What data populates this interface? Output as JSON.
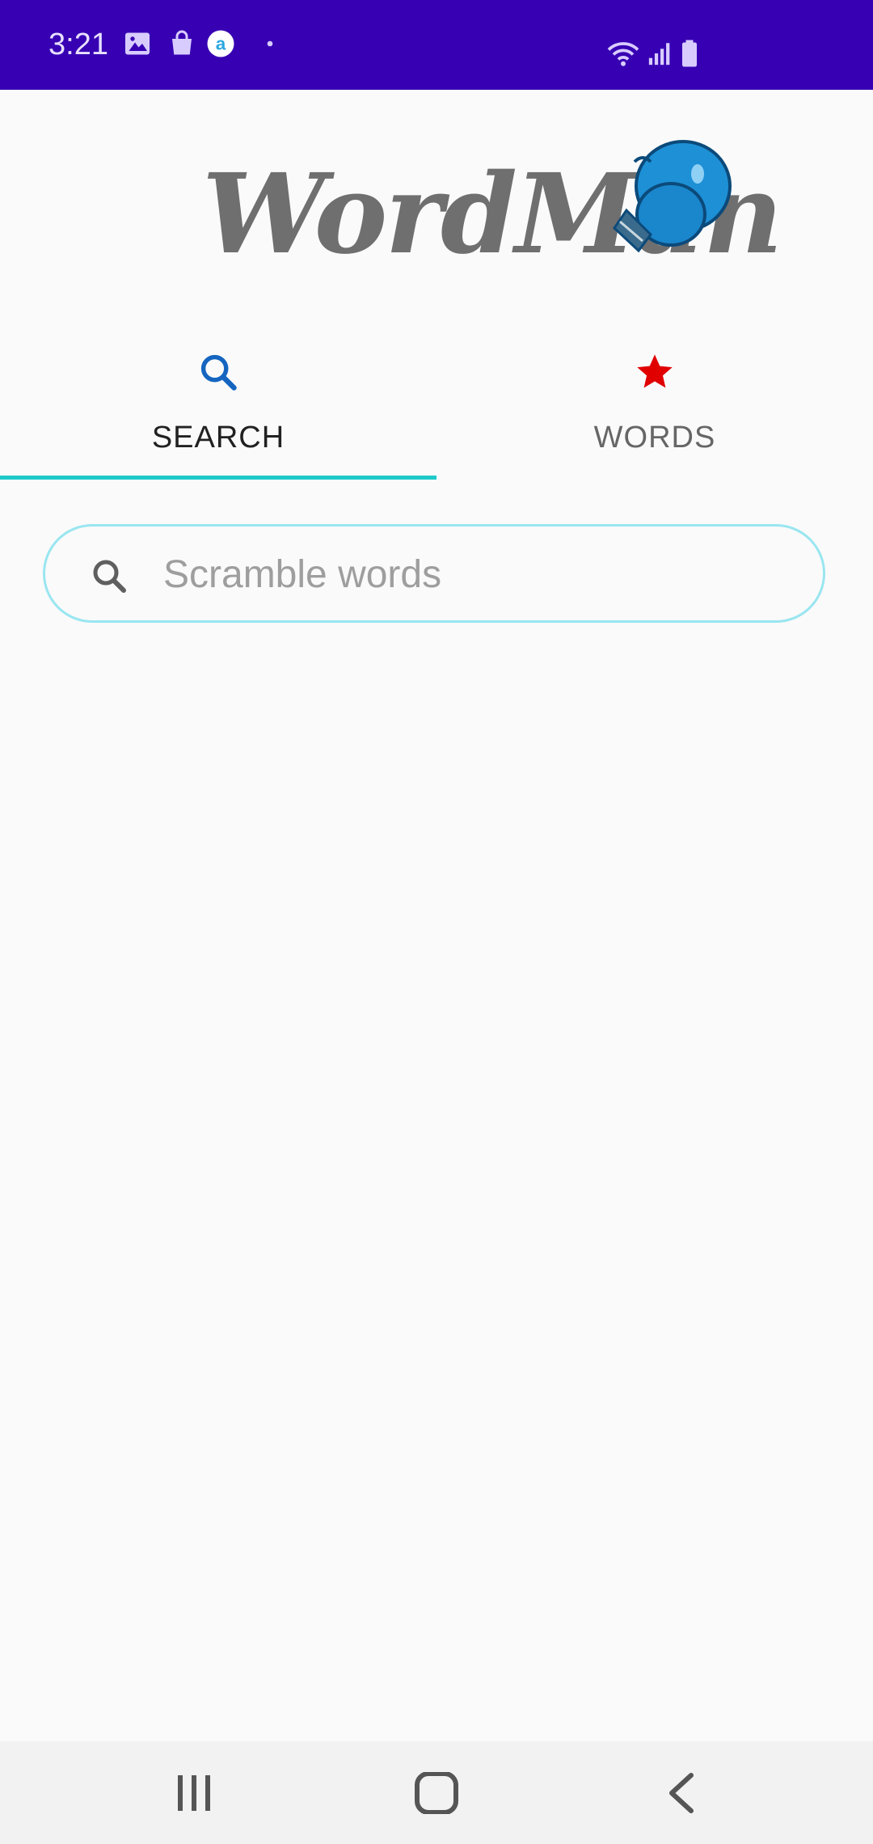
{
  "status_bar": {
    "time": "3:21",
    "background": "#3700b3",
    "left_icons": [
      "gallery-icon",
      "shopping-bag-icon",
      "app-notification-icon",
      "dot-icon"
    ],
    "right_icons": [
      "wifi-icon",
      "signal-icon",
      "battery-icon"
    ]
  },
  "logo": {
    "text": "WordMan",
    "image": "boxing-glove-icon"
  },
  "tabs": [
    {
      "label": "SEARCH",
      "icon": "search-icon",
      "active": true,
      "icon_color": "#1565c0"
    },
    {
      "label": "WORDS",
      "icon": "star-icon",
      "active": false,
      "icon_color": "#e00000"
    }
  ],
  "accent_color": "#1fc9c9",
  "search": {
    "placeholder": "Scramble words",
    "value": ""
  },
  "nav_bar": {
    "buttons": [
      "recent-apps-icon",
      "home-icon",
      "back-icon"
    ]
  }
}
